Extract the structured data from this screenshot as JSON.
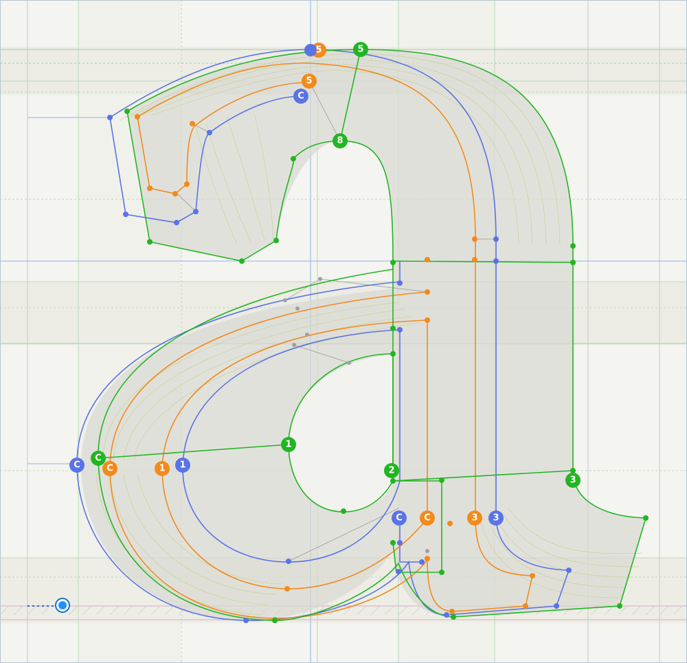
{
  "editor": {
    "glyph": "a",
    "view": "variable font interpolation preview",
    "colors": {
      "background": "#f4f4f1",
      "band": "#ecebe3",
      "guide_blue": "#8fb3e6",
      "guide_green": "#9dd19d",
      "baseline_pink": "#d9a9c9",
      "master_blue": "#5a73e6",
      "master_orange": "#f28a1c",
      "master_green": "#22b522",
      "intermediate": "#c9d59a",
      "fill": "#d8d8d2",
      "handle_gray": "#a0a0a0",
      "cursor": "#1e90ff"
    }
  },
  "point_labels": {
    "green": [
      "1",
      "2",
      "3",
      "5",
      "C",
      "8"
    ],
    "orange": [
      "1",
      "3",
      "5",
      "C",
      "C",
      "5"
    ],
    "blue": [
      "1",
      "3",
      "C",
      "C",
      "C"
    ]
  },
  "cursor": {
    "icon": "origin-point-icon"
  }
}
